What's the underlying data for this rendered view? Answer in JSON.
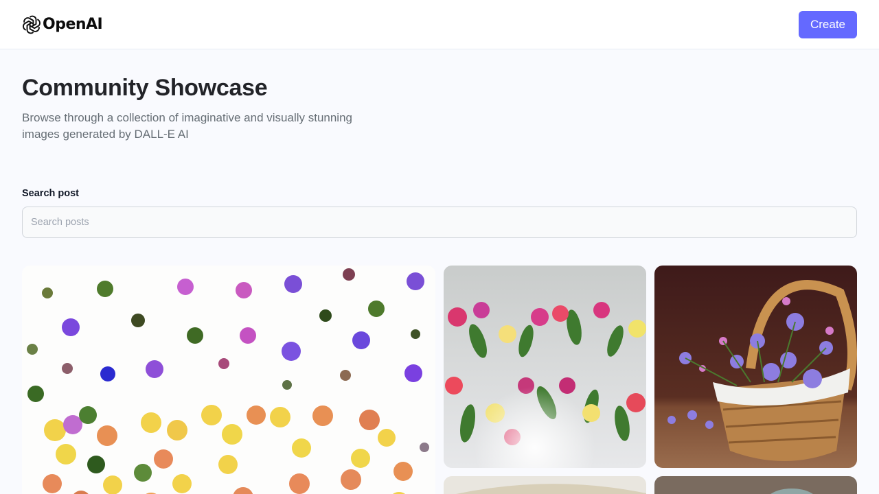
{
  "header": {
    "logo_text": "OpenAI",
    "logo_icon": "openai-logo-icon",
    "create_label": "Create"
  },
  "main": {
    "title": "Community Showcase",
    "subtitle": "Browse through a collection of imaginative and visually stunning images generated by DALL-E AI",
    "search": {
      "label": "Search post",
      "placeholder": "Search posts",
      "value": ""
    }
  },
  "gallery": {
    "cards": [
      {
        "subject": "flowers spelling letters on white background"
      },
      {
        "subject": "pink and yellow flowers with green leaves on white"
      },
      {
        "subject": "wicker basket with purple flowers"
      },
      {
        "subject": "partially visible image"
      },
      {
        "subject": "partially visible image"
      }
    ]
  },
  "colors": {
    "accent": "#6469ff",
    "page_background": "#f9fafe",
    "title_text": "#222328",
    "subtitle_text": "#666e75"
  }
}
